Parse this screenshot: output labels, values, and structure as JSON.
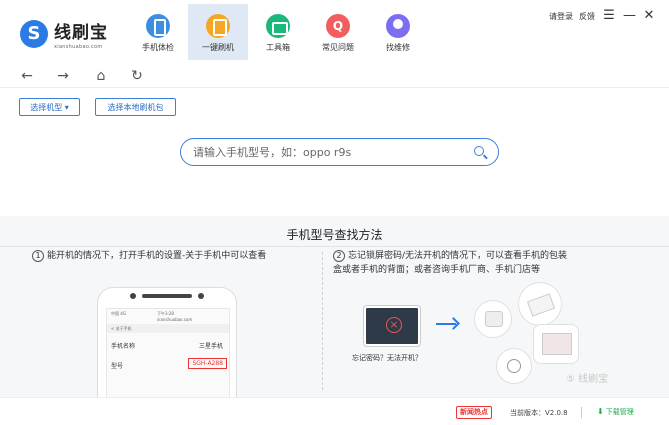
{
  "app": {
    "name": "线刷宝",
    "domain": "xianshuabao.com"
  },
  "tabs": [
    {
      "label": "手机体检",
      "icon": "phone-check-icon",
      "active": false
    },
    {
      "label": "一键刷机",
      "icon": "one-click-flash-icon",
      "active": true
    },
    {
      "label": "工具箱",
      "icon": "toolbox-icon",
      "active": false
    },
    {
      "label": "常见问题",
      "icon": "faq-icon",
      "active": false
    },
    {
      "label": "找维修",
      "icon": "repair-icon",
      "active": false
    }
  ],
  "header": {
    "login": "请登录",
    "feedback": "反馈",
    "menu_glyph": "☰",
    "minimize_glyph": "—",
    "close_glyph": "✕"
  },
  "nav": {
    "back_glyph": "←",
    "forward_glyph": "→",
    "home_glyph": "⌂",
    "refresh_glyph": "↻"
  },
  "actions": {
    "select_model": "选择机型 ▾",
    "select_local_rom": "选择本地刷机包"
  },
  "search": {
    "placeholder": "请输入手机型号，如：oppo r9s"
  },
  "guide": {
    "title": "手机型号查找方法",
    "step1_num": "1",
    "step1_text": "能开机的情况下，打开手机的设置-关于手机中可以查看",
    "step2_num": "2",
    "step2_line1": "忘记锁屏密码/无法开机的情况下，可以查看手机的包装",
    "step2_line2": "盒或者手机的背面；或者咨询手机厂商、手机门店等",
    "phone_screen": {
      "status": "中国 4G",
      "time": "下午3:28",
      "url": "xianshuabao.com",
      "header": "< 关于手机",
      "name_label": "手机名称",
      "name_value": "三星手机",
      "model_label": "型号",
      "model_value": "SGH-A288"
    },
    "lock_caption": "忘记密码？无法开机？",
    "watermark": "⑤ 线刷宝"
  },
  "status": {
    "news": "新闻热点",
    "version": "当前版本：V2.0.8",
    "download": "下载管理"
  },
  "colors": {
    "accent": "#2a7be4",
    "active_tab_bg": "#dfe9f6",
    "news_red": "#e33333",
    "download_green": "#1aa84a"
  }
}
